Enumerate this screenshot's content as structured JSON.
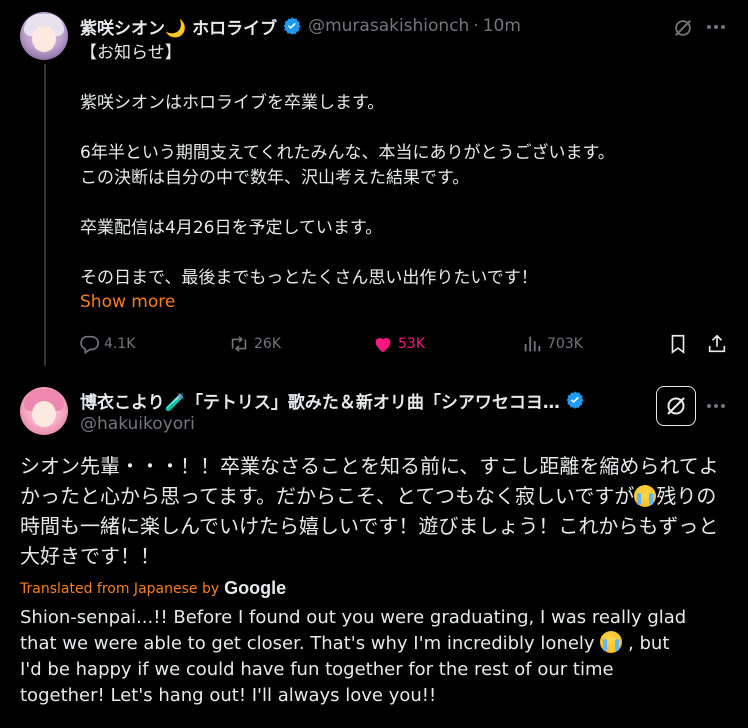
{
  "tweet1": {
    "display_name": "紫咲シオン🌙 ホロライブ",
    "handle": "@murasakishionch",
    "separator": "·",
    "time": "10m",
    "body_lines": [
      "【お知らせ】",
      "",
      "紫咲シオンはホロライブを卒業します。",
      "",
      "6年半という期間支えてくれたみんな、本当にありがとうございます。",
      "この決断は自分の中で数年、沢山考えた結果です。",
      "",
      "卒業配信は4月26日を予定しています。",
      "",
      "その日まで、最後までもっとたくさん思い出作りたいです！"
    ],
    "show_more": "Show more",
    "stats": {
      "replies": "4.1K",
      "reposts": "26K",
      "likes": "53K",
      "views": "703K"
    }
  },
  "tweet2": {
    "display_name": "博衣こより🧪「テトリス」歌みた＆新オリ曲「シアワセコヨ…",
    "handle": "@hakuikoyori",
    "body_part1": "シオン先輩・・・！！卒業なさることを知る前に、すこし距離を縮められてよかったと心から思ってます。だからこそ、とてつもなく寂しいですが",
    "body_part2": "残りの時間も一緒に楽しんでいけたら嬉しいです！遊びましょう！これからもずっと大好きです！！",
    "translated_label": "Translated from Japanese by",
    "translator": "Google",
    "translation_lines": [
      "Shion-senpai...!! Before I found out you were graduating, I was really glad",
      "that we were able to get closer. That's why I'm incredibly lonely",
      ", but",
      "I'd be happy if we could have fun together for the rest of our time",
      "together! Let's hang out! I'll always love you!!"
    ]
  },
  "icons": {
    "verified": "verified-badge-icon",
    "grok": "grok-icon",
    "more": "more-icon",
    "reply": "reply-icon",
    "repost": "repost-icon",
    "like": "heart-icon",
    "views": "views-icon",
    "bookmark": "bookmark-icon",
    "share": "share-icon",
    "emoji": "loudly-crying-face-emoji"
  },
  "colors": {
    "background": "#000000",
    "accent": "#f87f1c",
    "like": "#f91880",
    "verified": "#1d9bf0",
    "muted": "#71767b"
  }
}
